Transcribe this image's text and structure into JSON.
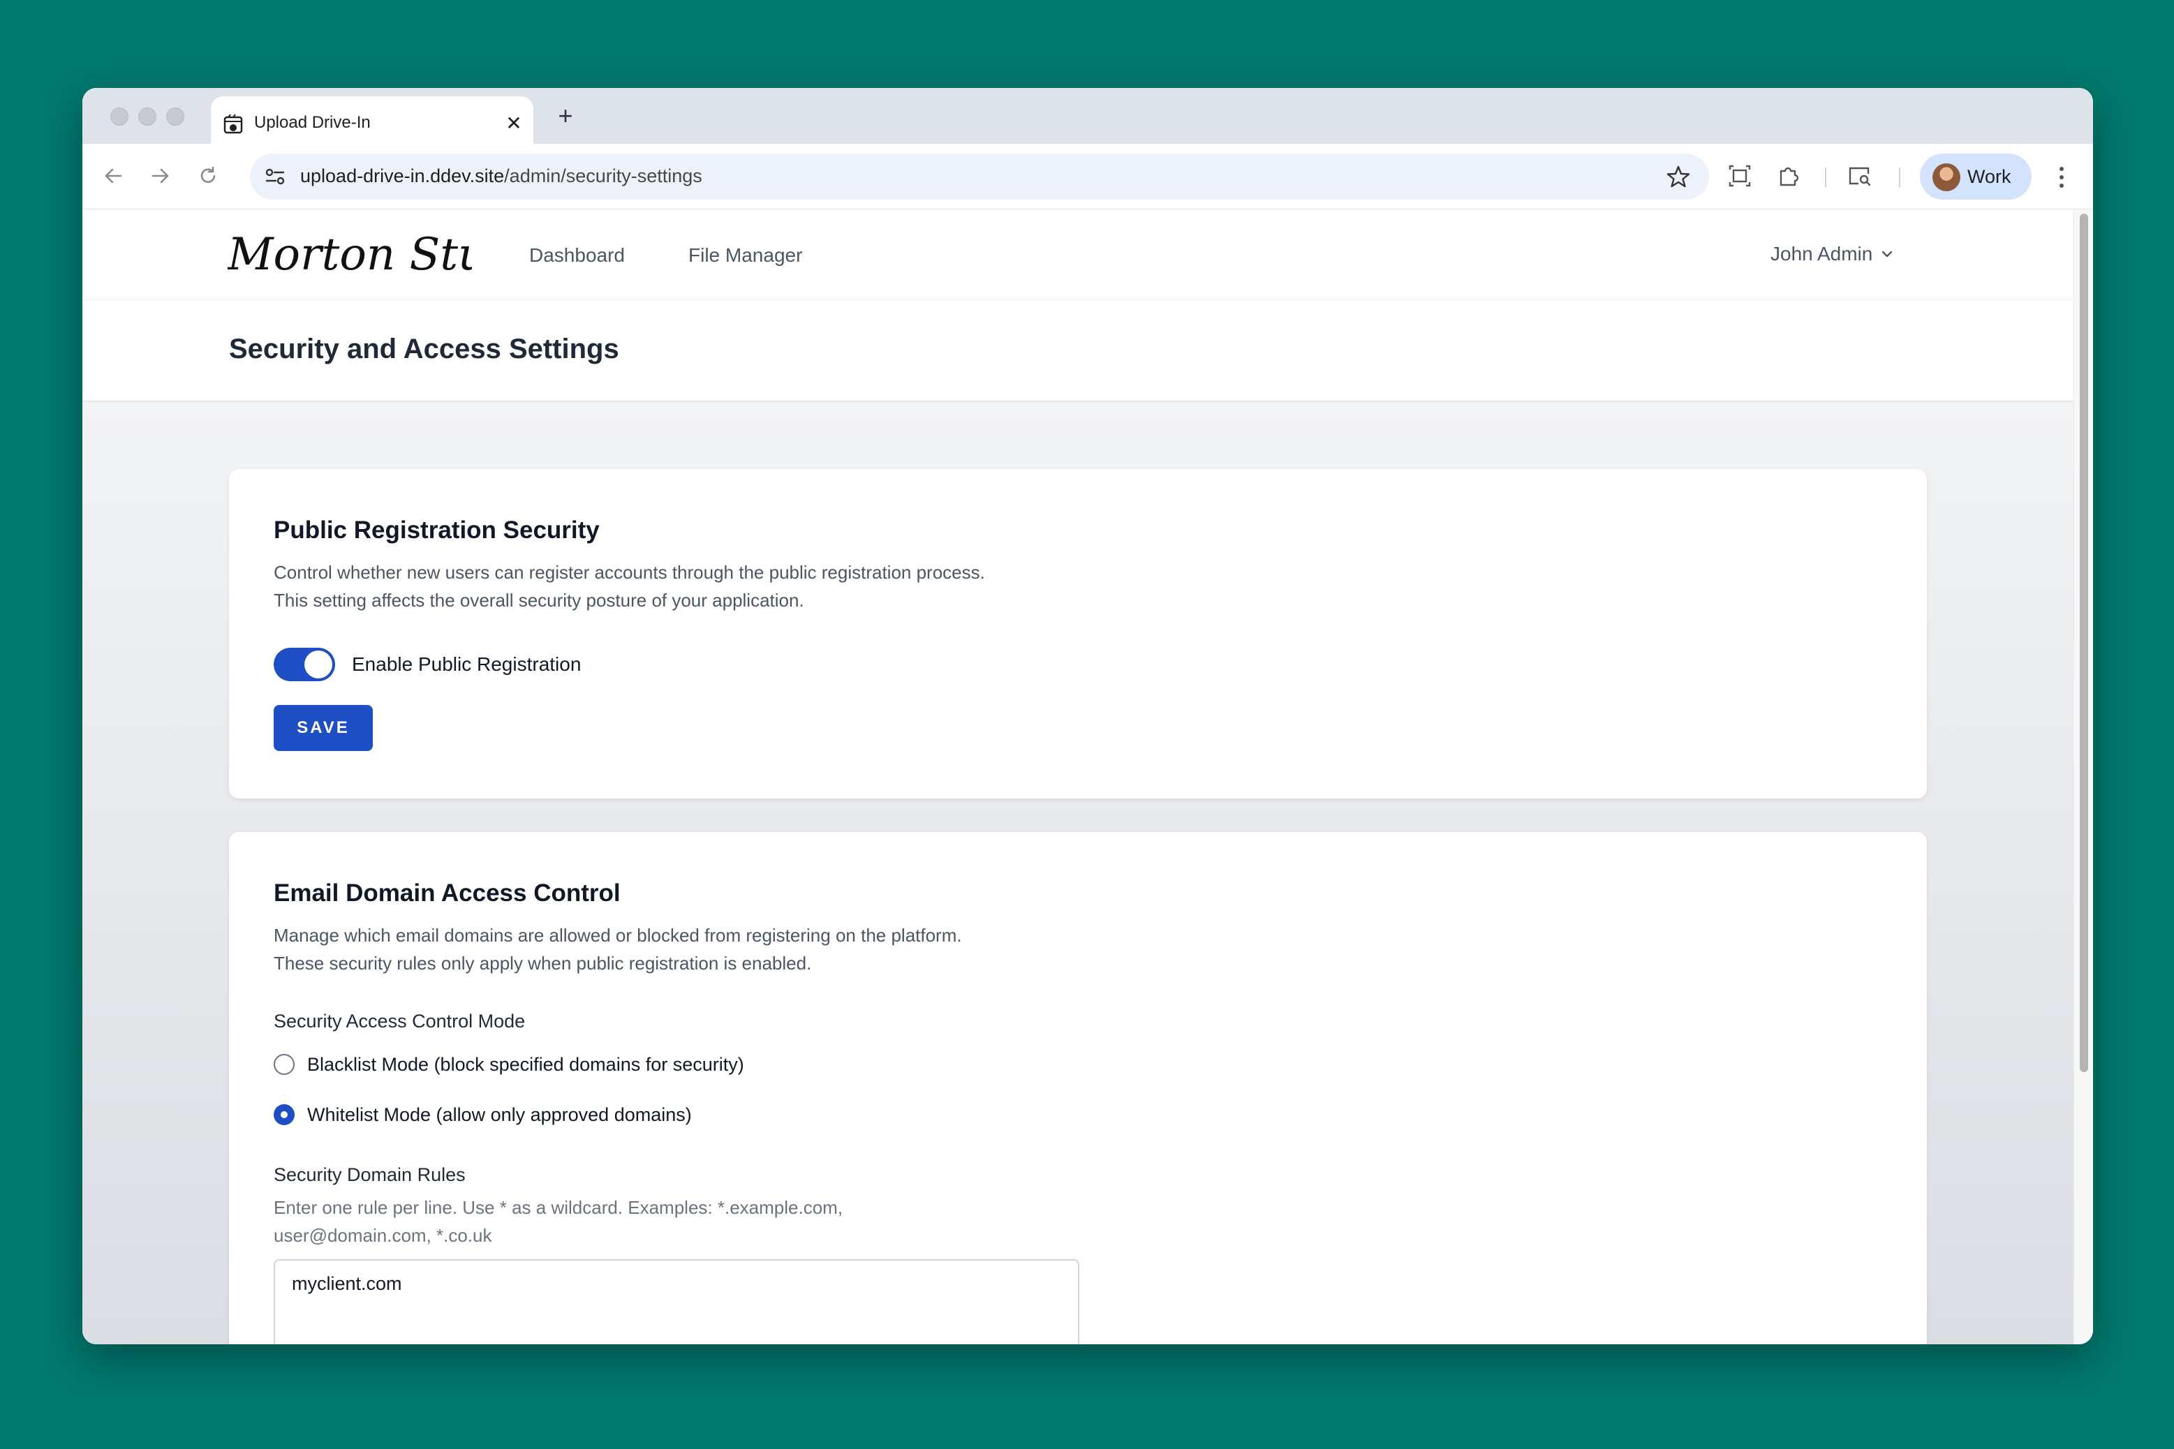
{
  "browser": {
    "tab_title": "Upload Drive-In",
    "url_host": "upload-drive-in.ddev.site",
    "url_path": "/admin/security-settings",
    "profile_label": "Work"
  },
  "app": {
    "logo_text": "Morton Studio",
    "nav": [
      "Dashboard",
      "File Manager"
    ],
    "user_name": "John Admin",
    "page_title": "Security and Access Settings"
  },
  "registration_card": {
    "title": "Public Registration Security",
    "description_line1": "Control whether new users can register accounts through the public registration process.",
    "description_line2": "This setting affects the overall security posture of your application.",
    "toggle_label": "Enable Public Registration",
    "toggle_on": true,
    "save_label": "SAVE"
  },
  "domain_card": {
    "title": "Email Domain Access Control",
    "description_line1": "Manage which email domains are allowed or blocked from registering on the platform.",
    "description_line2": "These security rules only apply when public registration is enabled.",
    "mode_label": "Security Access Control Mode",
    "modes": [
      {
        "label": "Blacklist Mode (block specified domains for security)",
        "checked": false
      },
      {
        "label": "Whitelist Mode (allow only approved domains)",
        "checked": true
      }
    ],
    "rules_label": "Security Domain Rules",
    "rules_help_line1": "Enter one rule per line. Use * as a wildcard. Examples: *.example.com,",
    "rules_help_line2": "user@domain.com, *.co.uk",
    "rules_value": "myclient.com"
  },
  "colors": {
    "accent": "#1e4ec4",
    "desktop_bg": "#00796e"
  }
}
